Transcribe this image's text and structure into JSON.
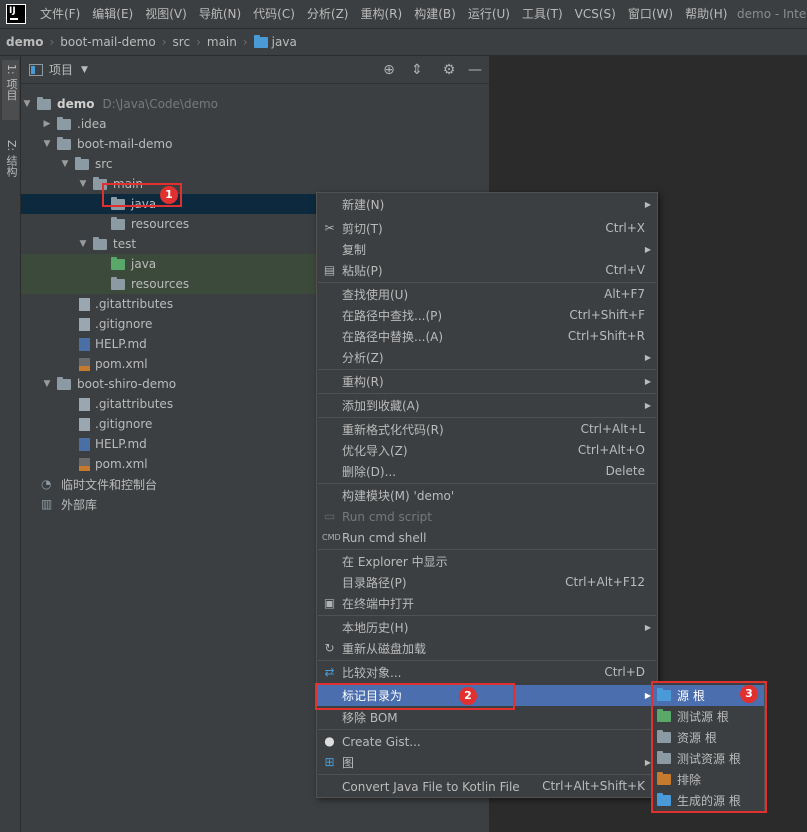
{
  "menubar": {
    "logo": "IJ",
    "items": [
      "文件(F)",
      "编辑(E)",
      "视图(V)",
      "导航(N)",
      "代码(C)",
      "分析(Z)",
      "重构(R)",
      "构建(B)",
      "运行(U)",
      "工具(T)",
      "VCS(S)",
      "窗口(W)",
      "帮助(H)"
    ],
    "window_title": "demo - Inte"
  },
  "breadcrumb": [
    "demo",
    "boot-mail-demo",
    "src",
    "main",
    "java"
  ],
  "tool_stripe": {
    "project_tab": "1: 项目",
    "structure_tab": "Z: 结构"
  },
  "project_panel": {
    "title": "项目",
    "tree": [
      {
        "label": "demo",
        "path": "D:\\Java\\Code\\demo",
        "icon": "module-folder-icon"
      },
      {
        "label": ".idea",
        "icon": "folder-icon"
      },
      {
        "label": "boot-mail-demo",
        "icon": "module-folder-icon"
      },
      {
        "label": "src",
        "icon": "folder-icon"
      },
      {
        "label": "main",
        "icon": "folder-icon"
      },
      {
        "label": "java",
        "icon": "folder-icon"
      },
      {
        "label": "resources",
        "icon": "folder-icon"
      },
      {
        "label": "test",
        "icon": "folder-icon"
      },
      {
        "label": "java",
        "icon": "test-source-folder-icon"
      },
      {
        "label": "resources",
        "icon": "test-resources-folder-icon"
      },
      {
        "label": ".gitattributes",
        "icon": "file-icon"
      },
      {
        "label": ".gitignore",
        "icon": "file-icon"
      },
      {
        "label": "HELP.md",
        "icon": "markdown-file-icon"
      },
      {
        "label": "pom.xml",
        "icon": "xml-file-icon"
      },
      {
        "label": "boot-shiro-demo",
        "icon": "module-folder-icon"
      },
      {
        "label": ".gitattributes",
        "icon": "file-icon"
      },
      {
        "label": ".gitignore",
        "icon": "file-icon"
      },
      {
        "label": "HELP.md",
        "icon": "markdown-file-icon"
      },
      {
        "label": "pom.xml",
        "icon": "xml-file-icon"
      },
      {
        "label": "临时文件和控制台",
        "icon": "scratches-icon"
      },
      {
        "label": "外部库",
        "icon": "libraries-icon"
      }
    ]
  },
  "context_menu": {
    "items": [
      {
        "label": "新建(N)",
        "shortcut": "",
        "submenu": true
      },
      {
        "label": "剪切(T)",
        "shortcut": "Ctrl+X",
        "icon": "scissors-icon"
      },
      {
        "label": "复制",
        "shortcut": "",
        "submenu": true
      },
      {
        "label": "粘贴(P)",
        "shortcut": "Ctrl+V",
        "icon": "clipboard-icon"
      },
      {
        "label": "查找使用(U)",
        "shortcut": "Alt+F7"
      },
      {
        "label": "在路径中查找...(P)",
        "shortcut": "Ctrl+Shift+F"
      },
      {
        "label": "在路径中替换...(A)",
        "shortcut": "Ctrl+Shift+R"
      },
      {
        "label": "分析(Z)",
        "shortcut": "",
        "submenu": true
      },
      {
        "label": "重构(R)",
        "shortcut": "",
        "submenu": true
      },
      {
        "label": "添加到收藏(A)",
        "shortcut": "",
        "submenu": true
      },
      {
        "label": "重新格式化代码(R)",
        "shortcut": "Ctrl+Alt+L"
      },
      {
        "label": "优化导入(Z)",
        "shortcut": "Ctrl+Alt+O"
      },
      {
        "label": "删除(D)...",
        "shortcut": "Delete"
      },
      {
        "label": "构建模块(M) 'demo'",
        "shortcut": ""
      },
      {
        "label": "Run cmd script",
        "shortcut": "",
        "disabled": true,
        "icon": "terminal-disabled-icon"
      },
      {
        "label": "Run cmd shell",
        "shortcut": "",
        "icon": "cmd-icon"
      },
      {
        "label": "在 Explorer 中显示",
        "shortcut": ""
      },
      {
        "label": "目录路径(P)",
        "shortcut": "Ctrl+Alt+F12"
      },
      {
        "label": "在终端中打开",
        "shortcut": "",
        "icon": "terminal-icon"
      },
      {
        "label": "本地历史(H)",
        "shortcut": "",
        "submenu": true
      },
      {
        "label": "重新从磁盘加载",
        "shortcut": "",
        "icon": "reload-icon"
      },
      {
        "label": "比较对象...",
        "shortcut": "Ctrl+D",
        "icon": "compare-icon"
      },
      {
        "label": "标记目录为",
        "shortcut": "",
        "submenu": true,
        "highlighted": true
      },
      {
        "label": "移除 BOM",
        "shortcut": ""
      },
      {
        "label": "Create Gist...",
        "shortcut": "",
        "icon": "github-icon"
      },
      {
        "label": "图",
        "shortcut": "",
        "submenu": true,
        "icon": "diagram-icon"
      },
      {
        "label": "Convert Java File to Kotlin File",
        "shortcut": "Ctrl+Alt+Shift+K"
      }
    ]
  },
  "submenu": {
    "items": [
      {
        "label": "源 根",
        "icon": "source-root-icon",
        "color": "#4a9ad7"
      },
      {
        "label": "测试源 根",
        "icon": "test-source-root-icon",
        "color": "#59a869"
      },
      {
        "label": "资源 根",
        "icon": "resource-root-icon",
        "color": "#8c9aa3"
      },
      {
        "label": "测试资源 根",
        "icon": "test-resource-root-icon",
        "color": "#8c9aa3"
      },
      {
        "label": "排除",
        "icon": "excluded-icon",
        "color": "#c57a2d"
      },
      {
        "label": "生成的源 根",
        "icon": "generated-source-root-icon",
        "color": "#4a9ad7"
      }
    ]
  },
  "callouts": [
    "1",
    "2",
    "3"
  ],
  "colors": {
    "accent": "#4b6eaf",
    "callout": "#e03030",
    "selection": "#0d293e"
  }
}
